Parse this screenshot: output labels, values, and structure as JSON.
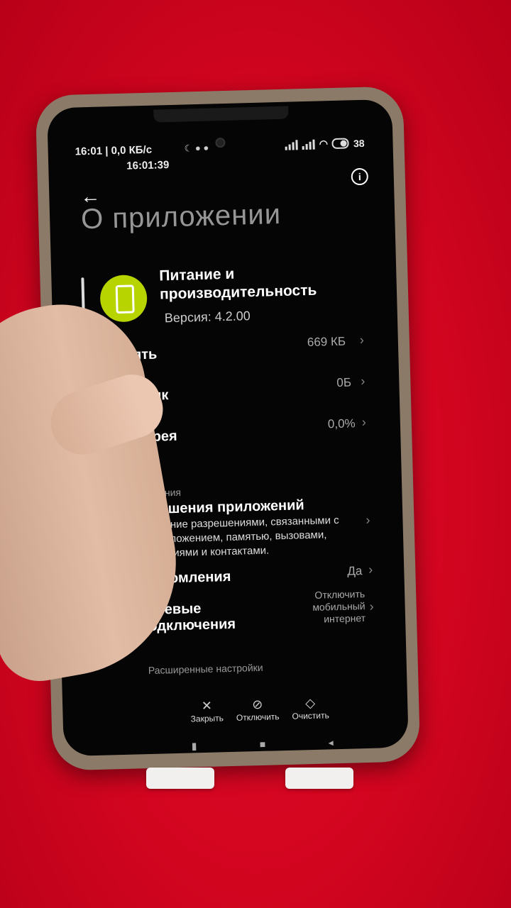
{
  "status_bar": {
    "left_text": "16:01 | 0,0 КБ/с",
    "clock": "16:01:39",
    "battery": "38"
  },
  "header": {
    "title": "О приложении",
    "back_icon": "arrow-left-icon",
    "info_icon": "info-icon"
  },
  "app": {
    "name": "Питание и производительность",
    "version": "Версия: 4.2.00",
    "icon_color": "#b7d400"
  },
  "rows": [
    {
      "label": "Память",
      "value": "669 КБ"
    },
    {
      "label": "Трафик",
      "value": "0Б"
    },
    {
      "label": "Батарея",
      "value": "0,0%"
    }
  ],
  "permissions": {
    "section": "Разрешения",
    "title": "Разрешения приложений",
    "description": "Управление разрешениями, связанными с местоположением, памятью, вызовами, сообщениями и контактами."
  },
  "notifications": {
    "label": "Уведомления",
    "value": "Да"
  },
  "network": {
    "label": "Сетевые подключения",
    "value": "Отключить мобильный интернет"
  },
  "advanced": {
    "label": "Расширенные настройки"
  },
  "actions": [
    {
      "label": "Закрыть",
      "icon": "close-icon"
    },
    {
      "label": "Отключить",
      "icon": "block-icon"
    },
    {
      "label": "Очистить",
      "icon": "eraser-icon"
    }
  ]
}
